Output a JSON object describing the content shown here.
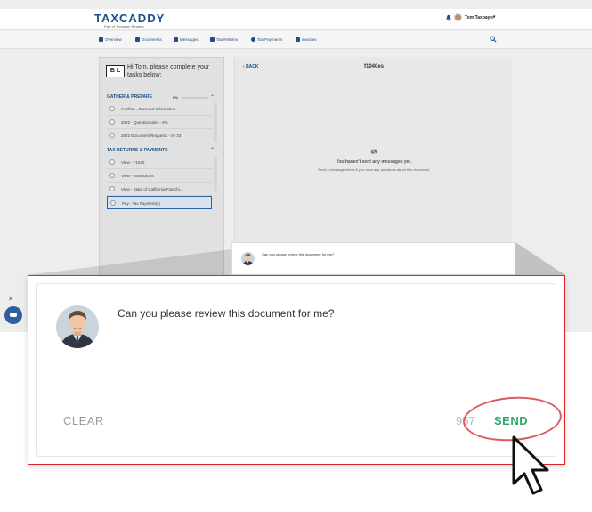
{
  "brand": {
    "logo": "TAXCADDY",
    "tagline": "Part of Thomson Reuters",
    "accent": "#1b4f8a",
    "success": "#2fa96b",
    "highlight_red": "#d9252a"
  },
  "header": {
    "user_name": "Tom Taxpayer"
  },
  "nav": {
    "items": [
      {
        "label": "Overview",
        "icon": "home-icon"
      },
      {
        "label": "Documents",
        "icon": "documents-icon"
      },
      {
        "label": "Messages",
        "icon": "messages-icon"
      },
      {
        "label": "Tax Returns",
        "icon": "tax-returns-icon"
      },
      {
        "label": "Tax Payments",
        "icon": "dollar-icon"
      },
      {
        "label": "Invoices",
        "icon": "invoice-icon"
      }
    ]
  },
  "tasks": {
    "logo_text": "B L",
    "greeting": "Hi Tom, please complete your tasks below:",
    "gather": {
      "title": "GATHER & PREPARE",
      "progress_label": "0%",
      "progress": 0.0,
      "items": [
        "Confirm - Personal Information",
        "2022 - Questionnaire - 2%",
        "2022 Document Requests - 0 / 33"
      ]
    },
    "returns": {
      "title": "TAX RETURNS & PAYMENTS",
      "items": [
        "View - F1040",
        "View - Instructions",
        "View - State of California Franchi...",
        "Pay - Tax Payment(s)"
      ]
    }
  },
  "messages": {
    "back_label": "BACK",
    "doc_title": "f1040es",
    "empty_title": "You haven't sent any messages yet.",
    "empty_sub": "Send a message below if you have any questions about this document.",
    "draft": "Can you please review this document for me?"
  },
  "compose": {
    "message": "Can you please review this document for me?",
    "clear_label": "CLEAR",
    "char_count": "957",
    "send_label": "SEND"
  }
}
